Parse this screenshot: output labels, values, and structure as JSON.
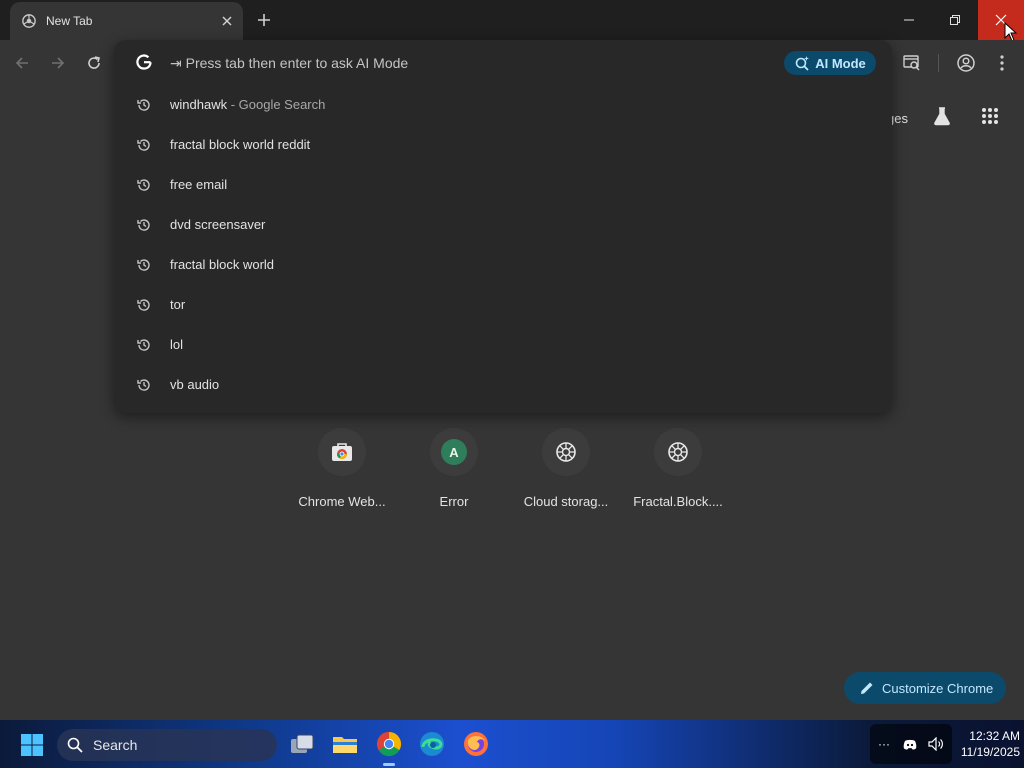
{
  "browser": {
    "tab_title": "New Tab",
    "new_tab_label": "+"
  },
  "omnibox": {
    "hint": "⇥ Press tab then enter to ask AI Mode",
    "ai_mode_label": "AI Mode",
    "suggestions": [
      {
        "text": "windhawk",
        "suffix": " - Google Search"
      },
      {
        "text": "fractal block world reddit",
        "suffix": ""
      },
      {
        "text": "free email",
        "suffix": ""
      },
      {
        "text": "dvd screensaver",
        "suffix": ""
      },
      {
        "text": "fractal block world",
        "suffix": ""
      },
      {
        "text": "tor",
        "suffix": ""
      },
      {
        "text": "lol",
        "suffix": ""
      },
      {
        "text": "vb audio",
        "suffix": ""
      }
    ]
  },
  "page": {
    "images_link": "ges",
    "shortcuts": [
      {
        "title": "Chrome Web...",
        "icon": "chrome-web-store-icon"
      },
      {
        "title": "Error",
        "icon": "letter-avatar",
        "letter": "A"
      },
      {
        "title": "Cloud storag...",
        "icon": "globe-icon"
      },
      {
        "title": "Fractal.Block....",
        "icon": "globe-icon"
      }
    ],
    "customize_label": "Customize Chrome"
  },
  "taskbar": {
    "search_label": "Search",
    "time": "12:32 AM",
    "date": "11/19/2025"
  },
  "colors": {
    "accent": "#0b4a6b",
    "accent_text": "#c2e7ff",
    "close_hover": "#c42b1c"
  }
}
